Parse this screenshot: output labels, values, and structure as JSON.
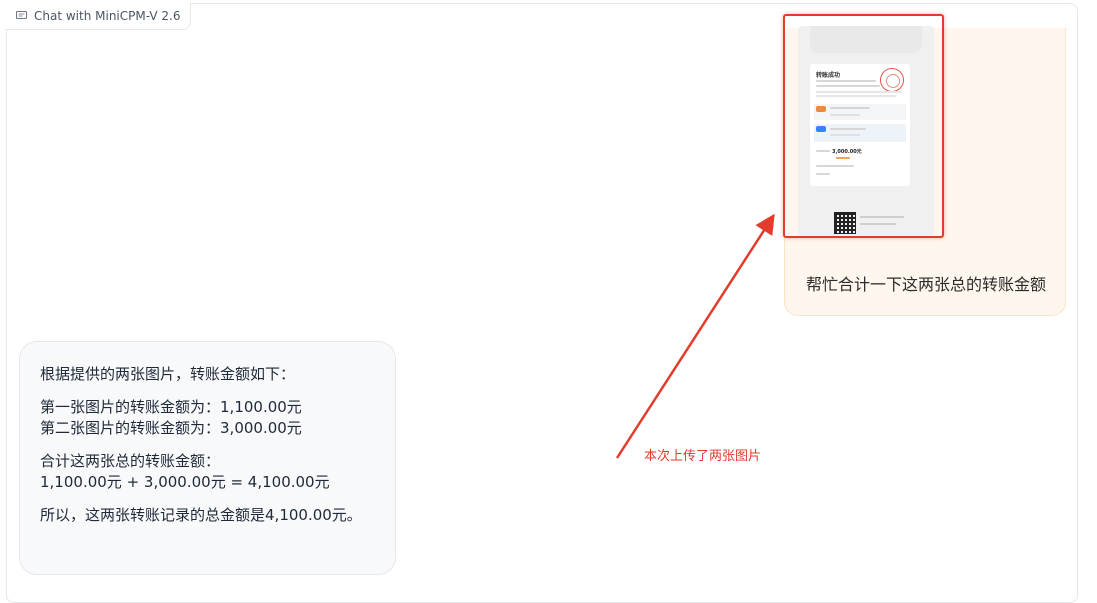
{
  "chat": {
    "tab_label": "Chat with MiniCPM-V 2.6"
  },
  "user_message": {
    "question": "帮忙合计一下这两张总的转账金额",
    "attachment": {
      "receipt_title": "转账成功",
      "amount": "3,000.00元"
    }
  },
  "annotation": {
    "text": "本次上传了两张图片",
    "color": "#e03a2b"
  },
  "bot_message": {
    "intro": "根据提供的两张图片，转账金额如下：",
    "line1": "第一张图片的转账金额为：1,100.00元",
    "line2": "第二张图片的转账金额为：3,000.00元",
    "sum_title": "合计这两张总的转账金额：",
    "sum_formula": "1,100.00元 + 3,000.00元 = 4,100.00元",
    "conclusion": "所以，这两张转账记录的总金额是4,100.00元。"
  },
  "colors": {
    "user_bubble_bg": "#fff7ed",
    "bot_bubble_bg": "#f8f9fb",
    "highlight": "#e23c2c"
  }
}
